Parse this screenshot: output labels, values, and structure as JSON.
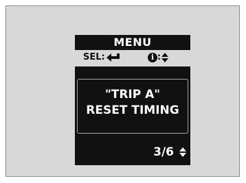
{
  "display": {
    "title": "MENU",
    "select_hint": {
      "label": "SEL:",
      "icon": "enter-arrow-icon"
    },
    "info_hint": {
      "icon_letter": "i",
      "separator": ":",
      "icon": "up-down-arrows-icon"
    },
    "message": {
      "line1": "\"TRIP A\"",
      "line2": "RESET TIMING"
    },
    "page_indicator": "3/6",
    "colors": {
      "panel": "#111111",
      "background": "#d8d8d8",
      "text": "#ffffff"
    }
  }
}
